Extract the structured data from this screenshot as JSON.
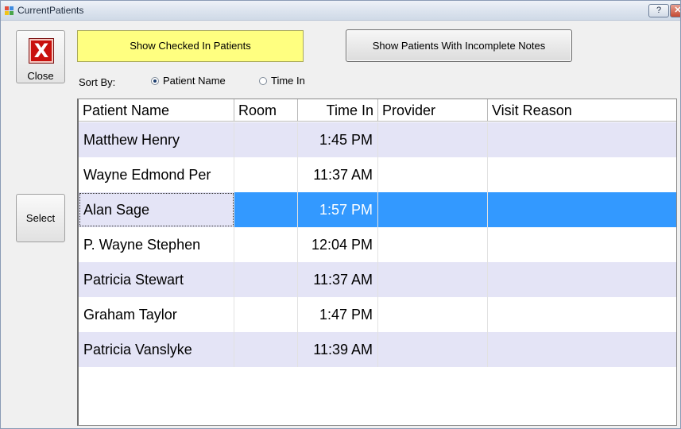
{
  "window": {
    "title": "CurrentPatients",
    "help_glyph": "?",
    "close_glyph": "✕"
  },
  "left_panel": {
    "close_label": "Close",
    "close_icon_glyph": "X",
    "select_label": "Select"
  },
  "toolbar": {
    "checked_in_label": "Show Checked In Patients",
    "incomplete_notes_label": "Show Patients With Incomplete Notes"
  },
  "sort": {
    "label": "Sort By:",
    "options": [
      {
        "label": "Patient Name",
        "selected": true
      },
      {
        "label": "Time In",
        "selected": false
      }
    ]
  },
  "grid": {
    "columns": [
      "Patient Name",
      "Room",
      "Time In",
      "Provider",
      "Visit Reason"
    ],
    "rows": [
      {
        "patient_name": "Matthew Henry",
        "room": "",
        "time_in": "1:45 PM",
        "provider": "",
        "visit_reason": ""
      },
      {
        "patient_name": "Wayne Edmond Per",
        "room": "",
        "time_in": "11:37 AM",
        "provider": "",
        "visit_reason": ""
      },
      {
        "patient_name": "Alan Sage",
        "room": "",
        "time_in": "1:57 PM",
        "provider": "",
        "visit_reason": ""
      },
      {
        "patient_name": "P. Wayne Stephen",
        "room": "",
        "time_in": "12:04 PM",
        "provider": "",
        "visit_reason": ""
      },
      {
        "patient_name": "Patricia Stewart",
        "room": "",
        "time_in": "11:37 AM",
        "provider": "",
        "visit_reason": ""
      },
      {
        "patient_name": "Graham Taylor",
        "room": "",
        "time_in": "1:47 PM",
        "provider": "",
        "visit_reason": ""
      },
      {
        "patient_name": "Patricia Vanslyke",
        "room": "",
        "time_in": "11:39 AM",
        "provider": "",
        "visit_reason": ""
      }
    ],
    "selected_row": 2
  },
  "colors": {
    "alt_row": "#e4e4f6",
    "selection": "#3399ff",
    "checked_in_button": "#ffff80"
  }
}
